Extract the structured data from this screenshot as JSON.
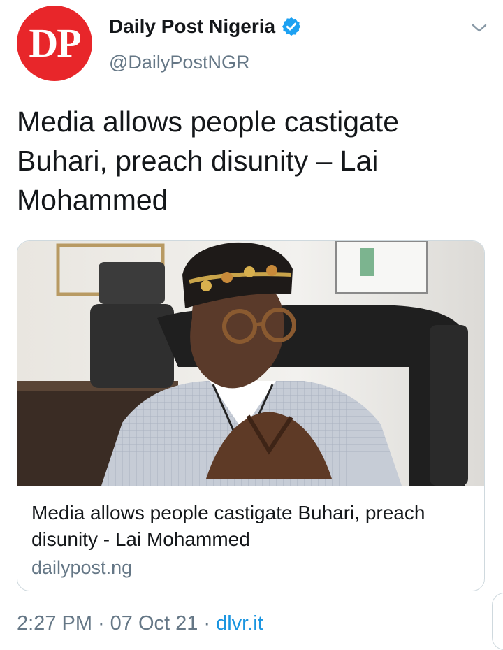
{
  "account": {
    "avatar_text": "DP",
    "display_name": "Daily Post Nigeria",
    "handle": "@DailyPostNGR",
    "verified": true
  },
  "tweet": {
    "text": "Media allows people castigate Buhari, preach disunity – Lai Mohammed"
  },
  "card": {
    "image_icon": "photo-of-man-in-embroidered-cap-and-glasses",
    "title": "Media allows people castigate Buhari, preach disunity - Lai Mohammed",
    "domain": "dailypost.ng"
  },
  "meta": {
    "time": "2:27 PM",
    "separator": "·",
    "date": "07 Oct 21",
    "source": "dlvr.it"
  },
  "colors": {
    "brand_red": "#e8262a",
    "verified_blue": "#1da1f2",
    "secondary_text": "#657786",
    "link": "#1b95e0"
  },
  "icons": {
    "verified": "verified-badge-icon",
    "menu": "chevron-down-icon"
  }
}
